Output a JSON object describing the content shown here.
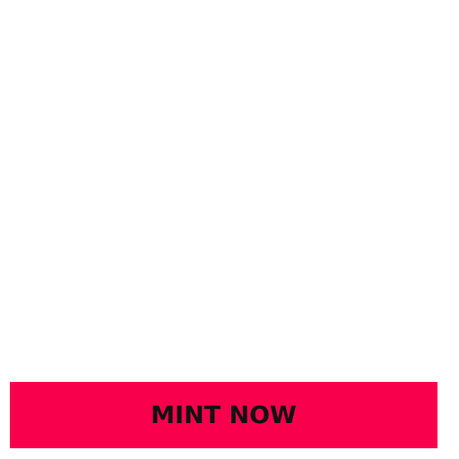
{
  "cta": {
    "label": "MINT NOW"
  },
  "colors": {
    "background": "#ffffff",
    "button": "#f8004c",
    "button_text": "#111111"
  }
}
